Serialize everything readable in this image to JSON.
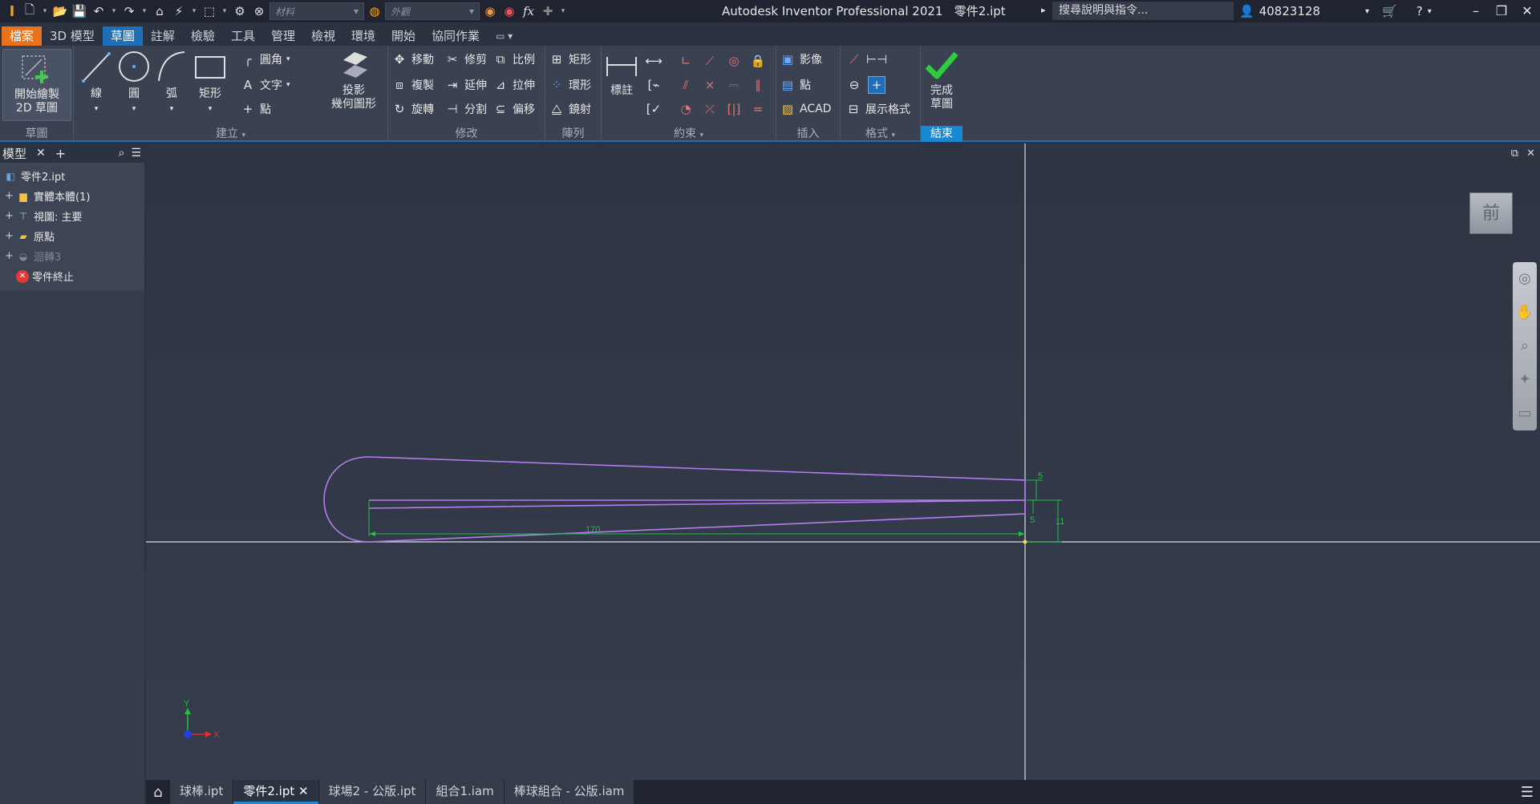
{
  "app": {
    "title": "Autodesk Inventor Professional 2021",
    "document": "零件2.ipt",
    "search_placeholder": "搜尋說明與指令...",
    "user": "40823128",
    "material_placeholder": "材料",
    "appearance_placeholder": "外觀"
  },
  "ribbon_tabs": [
    "檔案",
    "3D 模型",
    "草圖",
    "註解",
    "檢驗",
    "工具",
    "管理",
    "檢視",
    "環境",
    "開始",
    "協同作業"
  ],
  "panels": {
    "sketch": {
      "title": "草圖",
      "start_line1": "開始繪製",
      "start_line2": "2D 草圖"
    },
    "create": {
      "title": "建立",
      "line": "線",
      "circle": "圓",
      "arc": "弧",
      "rectangle": "矩形",
      "fillet": "圓角",
      "text": "文字",
      "point": "點",
      "project_line1": "投影",
      "project_line2": "幾何圖形"
    },
    "modify": {
      "title": "修改",
      "move": "移動",
      "trim": "修剪",
      "scale": "比例",
      "copy": "複製",
      "extend": "延伸",
      "stretch": "拉伸",
      "rotate": "旋轉",
      "split": "分割",
      "offset": "偏移"
    },
    "pattern": {
      "title": "陣列",
      "rectangular": "矩形",
      "circular": "環形",
      "mirror": "鏡射"
    },
    "constrain": {
      "title": "約束",
      "dimension": "標註"
    },
    "insert": {
      "title": "插入",
      "image": "影像",
      "points": "點",
      "acad": "ACAD"
    },
    "format": {
      "title": "格式",
      "show_format": "展示格式"
    },
    "exit": {
      "title": "結束",
      "finish_line1": "完成",
      "finish_line2": "草圖"
    }
  },
  "browser": {
    "tab": "模型",
    "items": [
      {
        "label": "零件2.ipt",
        "icon": "part-icon"
      },
      {
        "label": "實體本體(1)",
        "icon": "solid-bodies-icon"
      },
      {
        "label": "視圖: 主要",
        "icon": "view-icon"
      },
      {
        "label": "原點",
        "icon": "folder-icon"
      },
      {
        "label": "迴轉3",
        "icon": "revolve-icon"
      },
      {
        "label": "零件終止",
        "icon": "end-of-part-icon"
      }
    ]
  },
  "sketch": {
    "dim_length": "170",
    "dim_top": "5",
    "dim_bottom": "5",
    "dim_height": "11"
  },
  "viewcube": "前",
  "triad": {
    "x": "X",
    "y": "Y"
  },
  "document_tabs": [
    "球棒.ipt",
    "零件2.ipt",
    "球場2 - 公版.ipt",
    "組合1.iam",
    "棒球組合 - 公版.iam"
  ],
  "colors": {
    "accent": "#1f6fb8",
    "file_tab": "#e8731c",
    "sketch_line": "#b57cf2",
    "dimension": "#20c040",
    "finish_check": "#2ecc40"
  }
}
